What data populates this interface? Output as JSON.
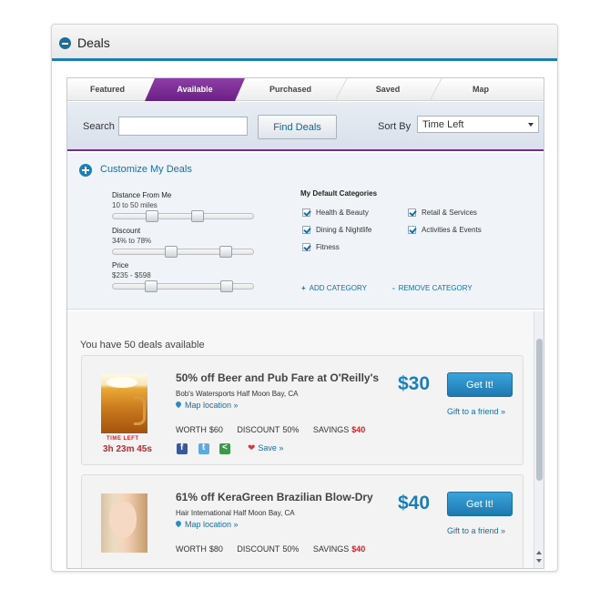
{
  "panel": {
    "title": "Deals"
  },
  "tabs": [
    {
      "label": "Featured"
    },
    {
      "label": "Available"
    },
    {
      "label": "Purchased"
    },
    {
      "label": "Saved"
    },
    {
      "label": "Map"
    }
  ],
  "active_tab": "Available",
  "search": {
    "label": "Search",
    "value": "",
    "button": "Find Deals",
    "sort_label": "Sort By",
    "sort_value": "Time Left"
  },
  "customize": {
    "title": "Customize My Deals",
    "sliders": [
      {
        "title": "Distance From Me",
        "value": "10 to 50 miles",
        "low": 10,
        "high": 50
      },
      {
        "title": "Discount",
        "value": "34% to 78%",
        "low": 34,
        "high": 78
      },
      {
        "title": "Price",
        "value": "$235 - $598",
        "low": 235,
        "high": 598
      }
    ],
    "categories_title": "My Default Categories",
    "categories": [
      {
        "label": "Health & Beauty",
        "checked": true
      },
      {
        "label": "Retail & Services",
        "checked": true
      },
      {
        "label": "Dining & Nightlife",
        "checked": true
      },
      {
        "label": "Activities & Events",
        "checked": true
      },
      {
        "label": "Fitness",
        "checked": true
      }
    ],
    "add_category": "ADD CATEGORY",
    "remove_category": "REMOVE CATEGORY"
  },
  "deals_summary": "You have 50 deals available",
  "deals": [
    {
      "title": "50% off Beer and Pub Fare at O'Reilly's",
      "merchant": "Bob's Watersports Half Moon Bay, CA",
      "map_link": "Map location »",
      "worth_label": "WORTH",
      "worth": "$60",
      "discount_label": "DISCOUNT",
      "discount": "50%",
      "savings_label": "SAVINGS",
      "savings": "$40",
      "price": "$30",
      "button": "Get It!",
      "gift": "Gift to a friend »",
      "time_left_label": "TIME LEFT",
      "time_left": "3h 23m 45s",
      "save": "Save »"
    },
    {
      "title": "61% off KeraGreen Brazilian Blow-Dry",
      "merchant": "Hair International Half Moon Bay, CA",
      "map_link": "Map location »",
      "worth_label": "WORTH",
      "worth": "$80",
      "discount_label": "DISCOUNT",
      "discount": "50%",
      "savings_label": "SAVINGS",
      "savings": "$40",
      "price": "$40",
      "button": "Get It!",
      "gift": "Gift to a friend »"
    }
  ],
  "colors": {
    "accent": "#1b7fb6",
    "tab_active": "#7b2c8f",
    "alert_red": "#c1272d"
  }
}
